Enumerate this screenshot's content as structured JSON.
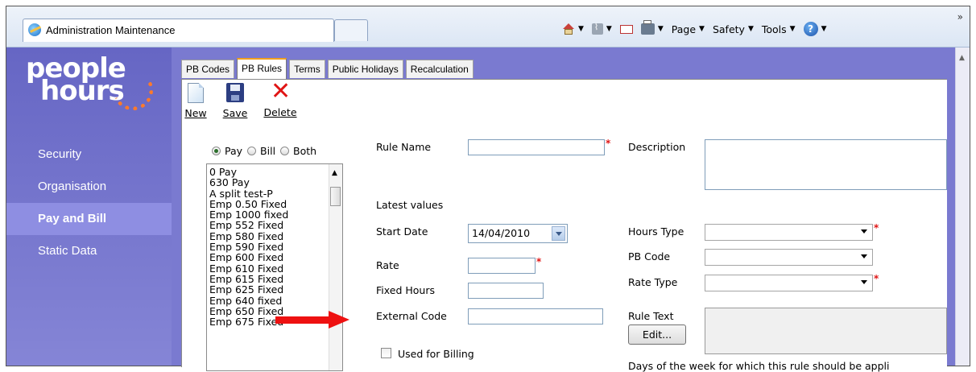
{
  "browser": {
    "tab_title": "Administration Maintenance",
    "commands": {
      "page": "Page",
      "safety": "Safety",
      "tools": "Tools"
    },
    "overflow": "»"
  },
  "logo": {
    "line1": "people",
    "line2": "hours"
  },
  "sidebar": {
    "items": [
      {
        "label": "Security"
      },
      {
        "label": "Organisation"
      },
      {
        "label": "Pay and Bill",
        "active": true
      },
      {
        "label": "Static Data"
      }
    ]
  },
  "tabs": [
    {
      "label": "PB Codes"
    },
    {
      "label": "PB Rules",
      "active": true
    },
    {
      "label": "Terms"
    },
    {
      "label": "Public Holidays"
    },
    {
      "label": "Recalculation"
    }
  ],
  "toolbar": {
    "new_label": "New",
    "save_label": "Save",
    "delete_label": "Delete"
  },
  "filter": {
    "pay": "Pay",
    "bill": "Bill",
    "both": "Both",
    "selected": "Pay"
  },
  "rules_list": [
    "0 Pay",
    "630 Pay",
    "A split test-P",
    "Emp 0.50 Fixed",
    "Emp 1000 fixed",
    "Emp 552 Fixed",
    "Emp 580 Fixed",
    "Emp 590 Fixed",
    "Emp 600 Fixed",
    "Emp 610 Fixed",
    "Emp 615 Fixed",
    "Emp 625 Fixed",
    "Emp 640 fixed",
    "Emp 650 Fixed",
    "Emp 675 Fixed"
  ],
  "form": {
    "rule_name_label": "Rule Name",
    "description_label": "Description",
    "latest_values_label": "Latest values",
    "start_date_label": "Start Date",
    "start_date_value": "14/04/2010",
    "rate_label": "Rate",
    "fixed_hours_label": "Fixed Hours",
    "external_code_label": "External Code",
    "used_for_billing_label": "Used for Billing",
    "hours_type_label": "Hours Type",
    "pb_code_label": "PB Code",
    "rate_type_label": "Rate Type",
    "rule_text_label": "Rule Text",
    "edit_button": "Edit...",
    "days_label": "Days of the week for which this rule should be appli",
    "required_mark": "*"
  },
  "colors": {
    "sidebar": "#7a7ad0",
    "active_nav": "#8e8ee2",
    "required": "#e01515",
    "arrow": "#ee1111"
  }
}
